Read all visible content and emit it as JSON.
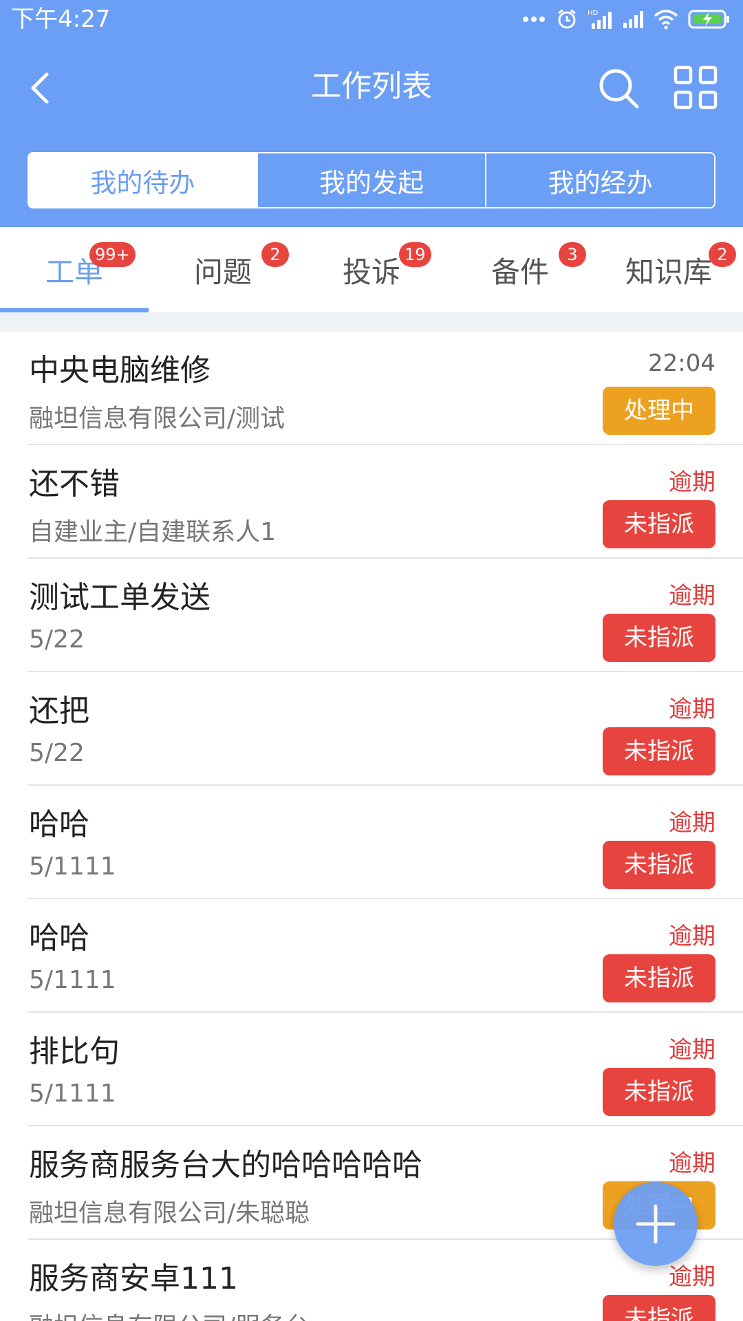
{
  "status_bar": {
    "time": "下午4:27",
    "icons": [
      "more-dots-icon",
      "alarm-icon",
      "hd-signal-icon",
      "signal-icon",
      "wifi-icon",
      "battery-charging-icon"
    ]
  },
  "header": {
    "title": "工作列表",
    "back_icon": "chevron-left-icon",
    "search_icon": "search-icon",
    "grid_icon": "grid-icon"
  },
  "segment": {
    "items": [
      {
        "label": "我的待办",
        "active": true
      },
      {
        "label": "我的发起",
        "active": false
      },
      {
        "label": "我的经办",
        "active": false
      }
    ]
  },
  "tabs": [
    {
      "label": "工单",
      "badge": "99+",
      "active": true
    },
    {
      "label": "问题",
      "badge": "2",
      "active": false
    },
    {
      "label": "投诉",
      "badge": "19",
      "active": false
    },
    {
      "label": "备件",
      "badge": "3",
      "active": false
    },
    {
      "label": "知识库",
      "badge": "2",
      "active": false
    }
  ],
  "list": {
    "items": [
      {
        "title": "中央电脑维修",
        "subtitle": "融坦信息有限公司/测试",
        "meta": "22:04",
        "status": "处理中",
        "status_color": "#eca121",
        "overdue": false
      },
      {
        "title": "还不错",
        "subtitle": "自建业主/自建联系人1",
        "meta": "逾期",
        "status": "未指派",
        "status_color": "#e8443f",
        "overdue": true
      },
      {
        "title": "测试工单发送",
        "subtitle": "5/22",
        "meta": "逾期",
        "status": "未指派",
        "status_color": "#e8443f",
        "overdue": true
      },
      {
        "title": "还把",
        "subtitle": "5/22",
        "meta": "逾期",
        "status": "未指派",
        "status_color": "#e8443f",
        "overdue": true
      },
      {
        "title": "哈哈",
        "subtitle": "5/1111",
        "meta": "逾期",
        "status": "未指派",
        "status_color": "#e8443f",
        "overdue": true
      },
      {
        "title": "哈哈",
        "subtitle": "5/1111",
        "meta": "逾期",
        "status": "未指派",
        "status_color": "#e8443f",
        "overdue": true
      },
      {
        "title": "排比句",
        "subtitle": "5/1111",
        "meta": "逾期",
        "status": "未指派",
        "status_color": "#e8443f",
        "overdue": true
      },
      {
        "title": "服务商服务台大的哈哈哈哈哈",
        "subtitle": "融坦信息有限公司/朱聪聪",
        "meta": "逾期",
        "status": "处理中",
        "status_color": "#eca121",
        "overdue": true
      },
      {
        "title": "服务商安卓111",
        "subtitle": "融坦信息有限公司/服务台",
        "meta": "逾期",
        "status": "未指派",
        "status_color": "#e8443f",
        "overdue": true
      }
    ]
  },
  "fab": {
    "icon": "plus-icon"
  },
  "colors": {
    "primary": "#6b9ef5",
    "overdue_text": "#e03a3a",
    "badge": "#e8443f",
    "processing": "#eca121",
    "unassigned": "#e8443f"
  }
}
